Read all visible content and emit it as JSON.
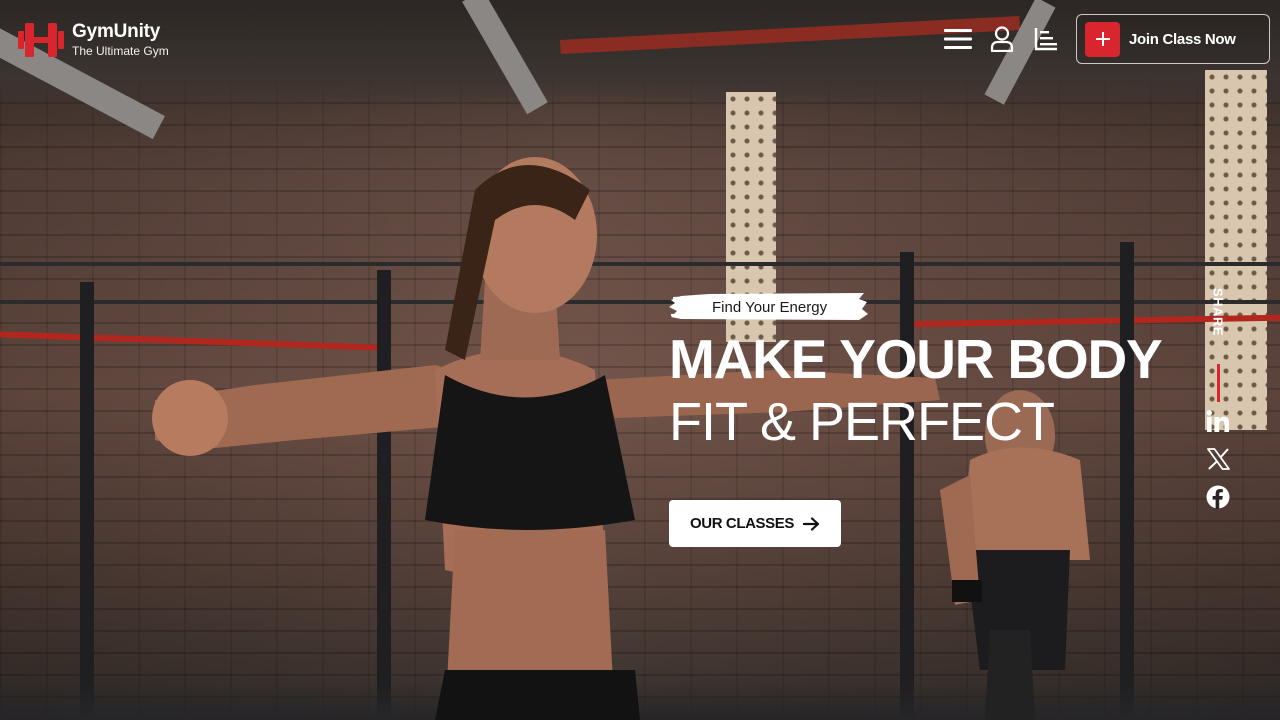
{
  "brand": {
    "name": "GymUnity",
    "tagline": "The Ultimate Gym",
    "accent_color": "#d9262e"
  },
  "header": {
    "menu_icon": "hamburger-menu-icon",
    "user_icon": "user-icon",
    "sort_icon": "bar-sort-icon",
    "join_button": {
      "label": "Join Class Now",
      "icon": "plus-icon"
    }
  },
  "hero": {
    "tagline": "Find Your Energy",
    "title_line1": "MAKE YOUR BODY",
    "title_line2": "FIT & PERFECT",
    "cta": {
      "label": "OUR CLASSES",
      "icon": "arrow-right-icon"
    }
  },
  "share": {
    "label": "SHARE",
    "icons": [
      "linkedin-icon",
      "x-twitter-icon",
      "facebook-icon"
    ]
  }
}
